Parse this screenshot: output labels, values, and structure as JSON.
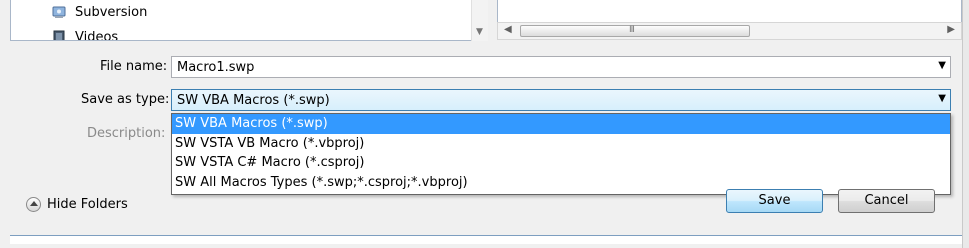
{
  "nav_tree": {
    "items": [
      {
        "label": "Subversion",
        "icon": "subversion-icon"
      },
      {
        "label": "Videos",
        "icon": "videos-icon"
      }
    ]
  },
  "form": {
    "file_name_label": "File name:",
    "file_name_value": "Macro1.swp",
    "save_type_label": "Save as type:",
    "save_type_value": "SW VBA Macros (*.swp)",
    "description_label": "Description:",
    "type_options": [
      "SW VBA Macros (*.swp)",
      "SW VSTA VB Macro (*.vbproj)",
      "SW VSTA C# Macro (*.csproj)",
      "SW All Macros Types (*.swp;*.csproj;*.vbproj)"
    ],
    "selected_option_index": 0
  },
  "hscroll": {
    "grip": "III"
  },
  "footer": {
    "hide_folders_label": "Hide Folders",
    "save_label": "Save",
    "cancel_label": "Cancel"
  },
  "colors": {
    "selection": "#3399ff",
    "focus_border": "#3c7fb1"
  }
}
